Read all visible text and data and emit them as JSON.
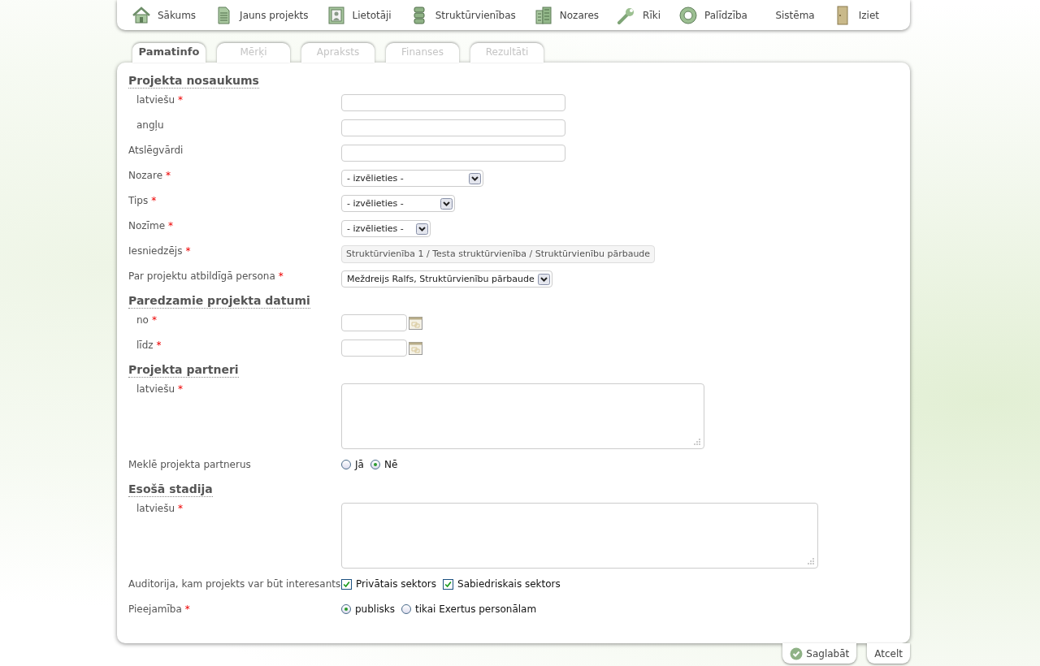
{
  "nav": {
    "items": [
      {
        "label": "Sākums"
      },
      {
        "label": "Jauns projekts"
      },
      {
        "label": "Lietotāji"
      },
      {
        "label": "Struktūrvienības"
      },
      {
        "label": "Nozares"
      },
      {
        "label": "Rīki"
      },
      {
        "label": "Palīdzība"
      }
    ],
    "right_items": [
      {
        "label": "Sistēma",
        "kind": "text"
      },
      {
        "label": "Iziet",
        "kind": "icon"
      }
    ]
  },
  "tabs": [
    {
      "label": "Pamatinfo",
      "selected": true
    },
    {
      "label": "Mērķi",
      "selected": false
    },
    {
      "label": "Apraksts",
      "selected": false
    },
    {
      "label": "Finanses",
      "selected": false
    },
    {
      "label": "Rezultāti",
      "selected": false
    }
  ],
  "form": [
    {
      "kind": "section",
      "title": "Projekta nosaukums",
      "fields": [
        {
          "kind": "text",
          "label": "latviešu",
          "mark": "*"
        },
        {
          "kind": "text",
          "label": "angļu"
        }
      ]
    },
    {
      "kind": "text",
      "label": "Atslēgvārdi"
    },
    {
      "kind": "select",
      "label": "Nozare",
      "mark": "*",
      "value": "- izvēlieties -"
    },
    {
      "kind": "select",
      "label": "Tips",
      "mark": "*",
      "value": "- izvēlieties -"
    },
    {
      "kind": "select",
      "label": "Nozīme",
      "mark": "*",
      "value": "- izvēlieties -"
    },
    {
      "kind": "static",
      "label": "Iesniedzējs",
      "mark": "*",
      "value": "Struktūrvienība 1 / Testa struktūrvienība / Struktūrvienību pārbaude"
    },
    {
      "kind": "select",
      "label": "Par projektu atbildīgā persona",
      "mark": "*",
      "value": "Meždreijs Ralfs, Struktūrvienību pārbaude"
    },
    {
      "kind": "section",
      "title": "Paredzamie projekta datumi",
      "fields": [
        {
          "kind": "date",
          "label": "no",
          "mark": "*"
        },
        {
          "kind": "date",
          "label": "līdz",
          "mark": "*"
        }
      ]
    },
    {
      "kind": "section",
      "title": "Projekta partneri",
      "fields": [
        {
          "kind": "textarea",
          "label": "latviešu",
          "mark": "*"
        }
      ]
    },
    {
      "kind": "radio",
      "label": "Meklē projekta partnerus",
      "options": [
        {
          "label": "Jā",
          "selected": false
        },
        {
          "label": "Nē",
          "selected": true
        }
      ]
    },
    {
      "kind": "section",
      "title": "Esošā stadija",
      "fields": [
        {
          "kind": "textarea",
          "label": "latviešu",
          "mark": "*"
        }
      ]
    },
    {
      "kind": "checkbox",
      "label": "Auditorija, kam projekts var būt interesants",
      "options": [
        {
          "label": "Privātais sektors",
          "checked": true
        },
        {
          "label": "Sabiedriskais sektors",
          "checked": true
        }
      ]
    },
    {
      "kind": "radio",
      "label": "Pieejamība",
      "mark": "*",
      "options": [
        {
          "label": "publisks",
          "selected": true
        },
        {
          "label": "tikai Exertus personālam",
          "selected": false
        }
      ]
    }
  ],
  "actions": [
    {
      "label": "Saglabāt",
      "kind": "save"
    },
    {
      "label": "Atcelt",
      "kind": "plain"
    }
  ]
}
